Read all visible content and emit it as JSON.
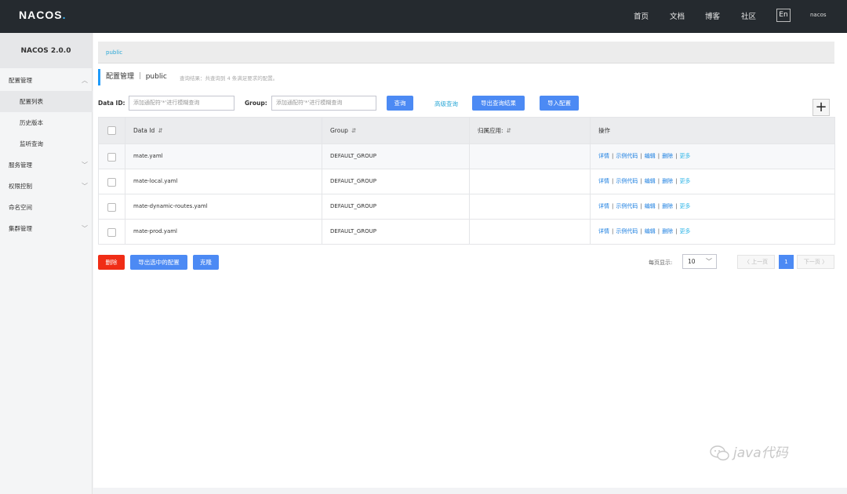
{
  "header": {
    "logo": "NACOS",
    "nav": [
      "首页",
      "文档",
      "博客",
      "社区"
    ],
    "lang": "En",
    "user": "nacos"
  },
  "sidebar": {
    "version": "NACOS 2.0.0",
    "items": [
      {
        "label": "配置管理",
        "expandable": true
      },
      {
        "label": "配置列表",
        "sub": true,
        "active": true
      },
      {
        "label": "历史版本",
        "sub": true
      },
      {
        "label": "监听查询",
        "sub": true
      },
      {
        "label": "服务管理",
        "expandable": true
      },
      {
        "label": "权限控制",
        "expandable": true
      },
      {
        "label": "命名空间"
      },
      {
        "label": "集群管理",
        "expandable": true
      }
    ]
  },
  "namespace": {
    "current": "public"
  },
  "title": {
    "text": "配置管理 ｜ public",
    "hint": "查询结果：共查询到 4 条满足要求的配置。"
  },
  "search": {
    "dataid_label": "Data ID:",
    "dataid_placeholder": "添加通配符'*'进行模糊查询",
    "group_label": "Group:",
    "group_placeholder": "添加通配符'*'进行模糊查询",
    "query_btn": "查询",
    "advanced": "高级查询",
    "export_btn": "导出查询结果",
    "import_btn": "导入配置",
    "add_btn": "+"
  },
  "table": {
    "headers": [
      "Data Id",
      "Group",
      "归属应用:",
      "操作"
    ],
    "rows": [
      {
        "dataid": "mate.yaml",
        "group": "DEFAULT_GROUP",
        "app": ""
      },
      {
        "dataid": "mate-local.yaml",
        "group": "DEFAULT_GROUP",
        "app": ""
      },
      {
        "dataid": "mate-dynamic-routes.yaml",
        "group": "DEFAULT_GROUP",
        "app": ""
      },
      {
        "dataid": "mate-prod.yaml",
        "group": "DEFAULT_GROUP",
        "app": ""
      }
    ],
    "ops": [
      "详情",
      "示例代码",
      "编辑",
      "删除"
    ],
    "more": "更多"
  },
  "bottom": {
    "delete_btn": "删除",
    "export_selected": "导出选中的配置",
    "clone_btn": "克隆",
    "page_size_label": "每页显示:",
    "page_size": "10",
    "prev": "〈 上一页",
    "page": "1",
    "next": "下一页 〉"
  },
  "watermark": "java代码"
}
